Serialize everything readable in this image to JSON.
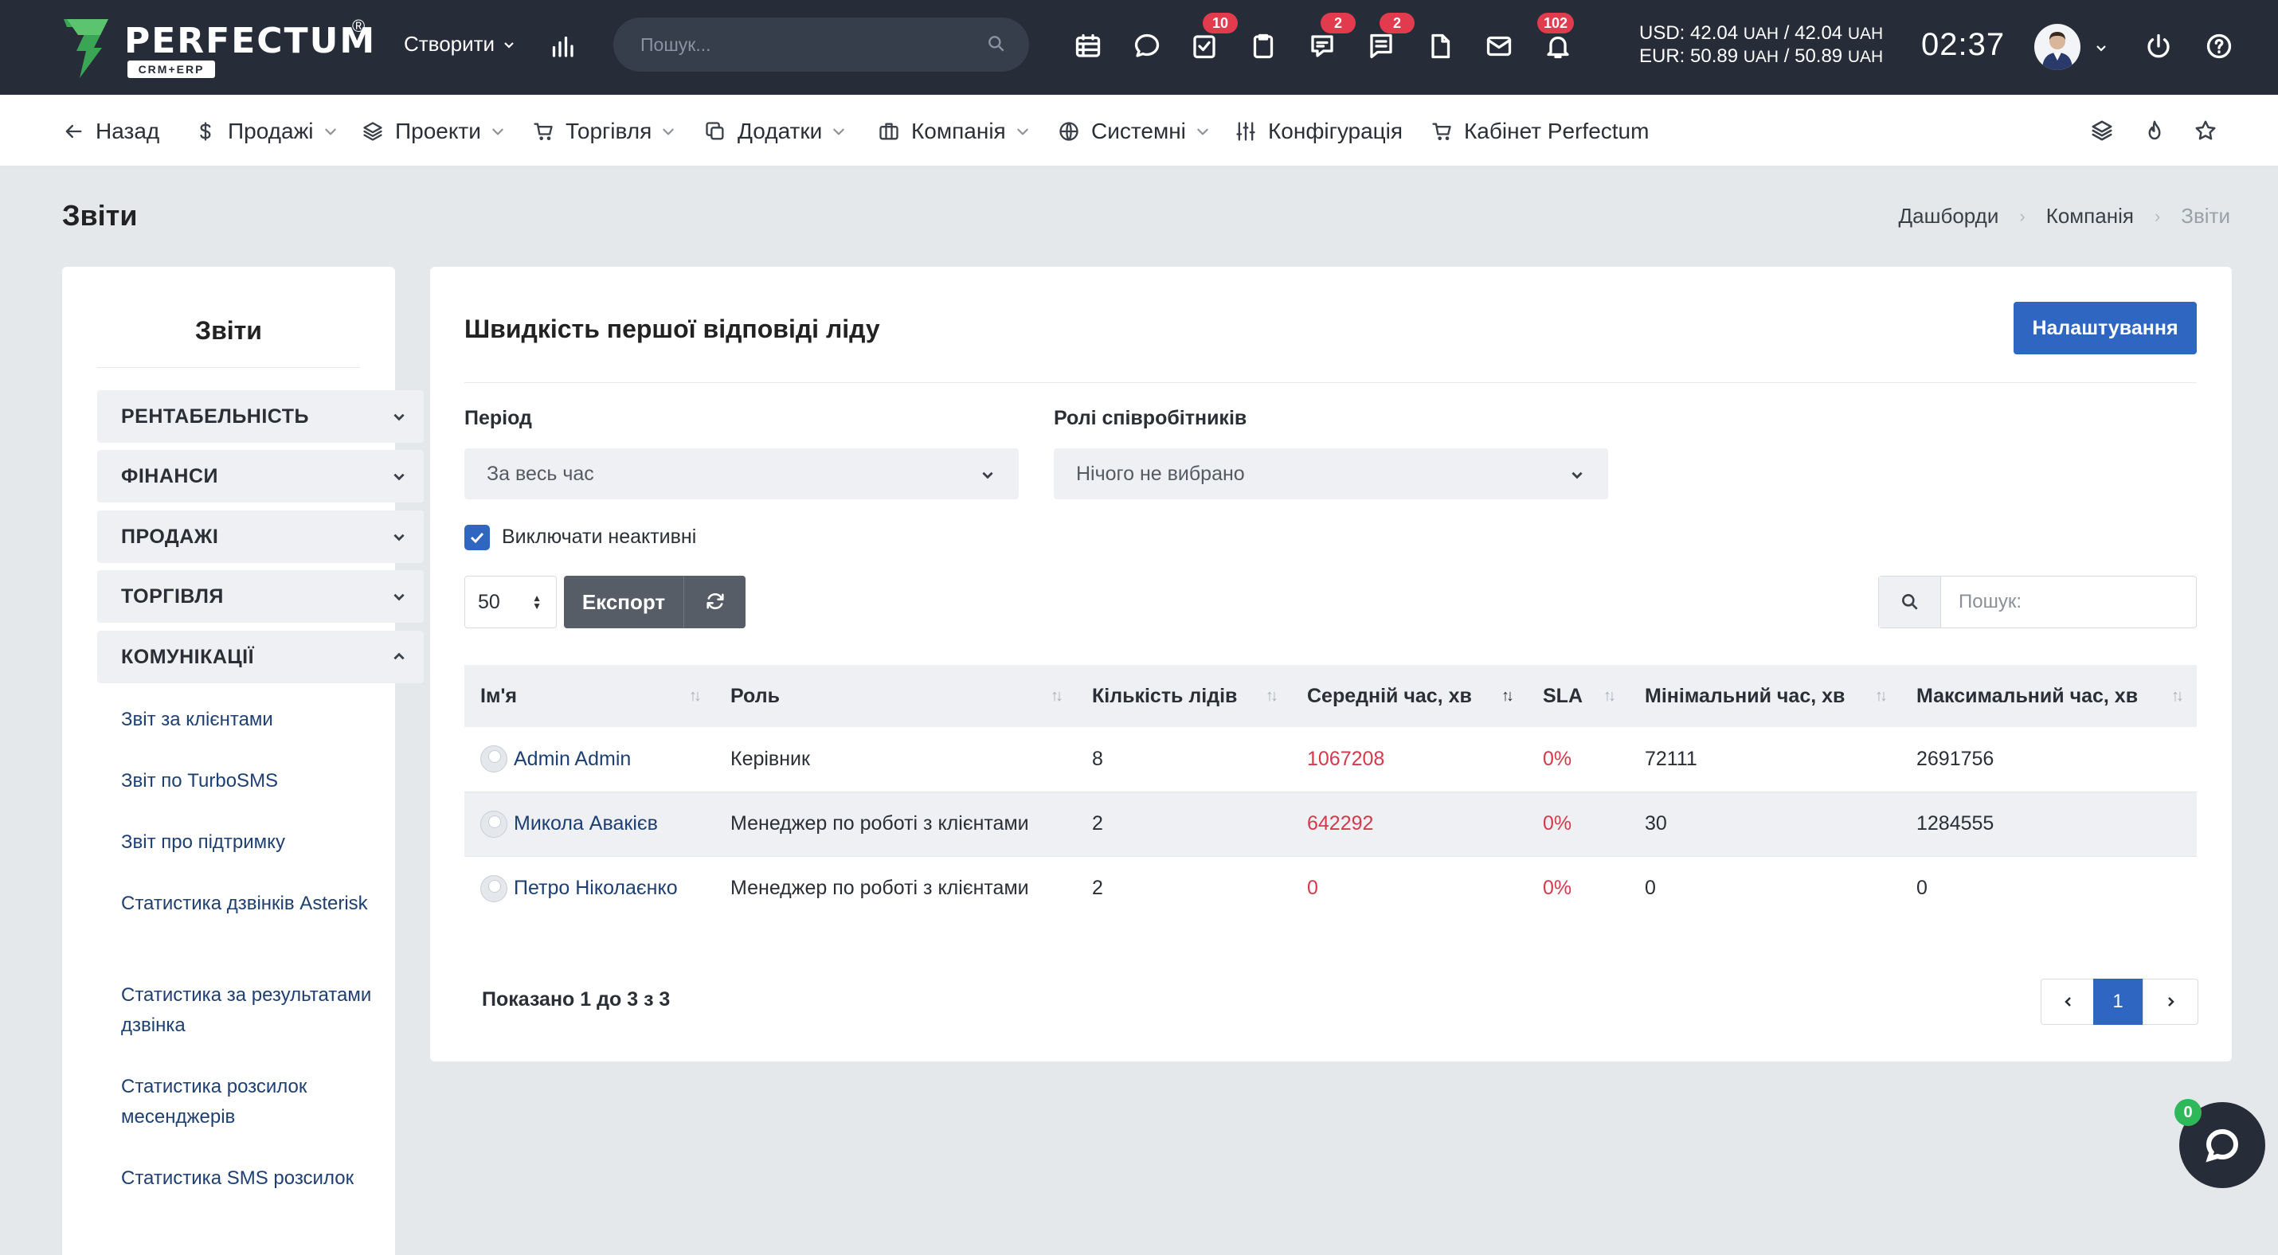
{
  "brand": {
    "name": "PERFECTUM",
    "sub": "CRM+ERP",
    "reg": "®"
  },
  "topbar": {
    "create_label": "Створити",
    "search_placeholder": "Пошук...",
    "badges": {
      "tasks": "10",
      "chat": "2",
      "comments": "2",
      "notifications": "102"
    },
    "rates": {
      "usd": "USD: 42.04",
      "usd_mid": " / 42.04 ",
      "eur": "EUR: 50.89",
      "eur_mid": " / 50.89 ",
      "unit": "UAH"
    },
    "clock": "02:37"
  },
  "nav": {
    "back": "Назад",
    "sales": "Продажі",
    "projects": "Проекти",
    "trade": "Торгівля",
    "addons": "Додатки",
    "company": "Компанія",
    "system": "Системні",
    "config": "Конфігурація",
    "cabinet": "Кабінет Perfectum"
  },
  "page": {
    "title": "Звіти",
    "breadcrumb": [
      "Дашборди",
      "Компанія",
      "Звіти"
    ]
  },
  "sidebar": {
    "title": "Звіти",
    "groups": [
      "РЕНТАБЕЛЬНІСТЬ",
      "ФІНАНСИ",
      "ПРОДАЖІ",
      "ТОРГІВЛЯ",
      "КОМУНІКАЦІЇ"
    ],
    "links": [
      "Звіт за клієнтами",
      "Звіт по TurboSMS",
      "Звіт про підтримку",
      "Статистика дзвінків Asterisk",
      "Статистика за результатами дзвінка",
      "Статистика розсилок месенджерів",
      "Статистика SMS розсилок"
    ]
  },
  "report": {
    "title": "Швидкість першої відповіді ліду",
    "settings_label": "Налаштування",
    "period_label": "Період",
    "period_value": "За весь час",
    "roles_label": "Ролі співробітників",
    "roles_value": "Нічого не вибрано",
    "exclude_inactive_label": "Виключати неактивні",
    "exclude_inactive_checked": true,
    "page_length": "50",
    "export_label": "Експорт",
    "search_placeholder": "Пошук:",
    "columns": [
      "Ім'я",
      "Роль",
      "Кількість лідів",
      "Середній час, хв",
      "SLA",
      "Мінімальний час, хв",
      "Максимальний час, хв"
    ],
    "rows": [
      {
        "name": "Admin Admin",
        "role": "Керівник",
        "leads": "8",
        "avg": "1067208",
        "sla": "0%",
        "min": "72111",
        "max": "2691756"
      },
      {
        "name": "Микола Авакієв",
        "role": "Менеджер по роботі з клієнтами",
        "leads": "2",
        "avg": "642292",
        "sla": "0%",
        "min": "30",
        "max": "1284555"
      },
      {
        "name": "Петро Ніколаєнко",
        "role": "Менеджер по роботі з клієнтами",
        "leads": "2",
        "avg": "0",
        "sla": "0%",
        "min": "0",
        "max": "0"
      }
    ],
    "info": "Показано 1 до 3 з 3",
    "current_page": "1"
  },
  "chat": {
    "count": "0"
  },
  "colors": {
    "topbar": "#262d38",
    "primary": "#2e66c1",
    "danger": "#d33a4c",
    "link": "#1d3f72"
  }
}
